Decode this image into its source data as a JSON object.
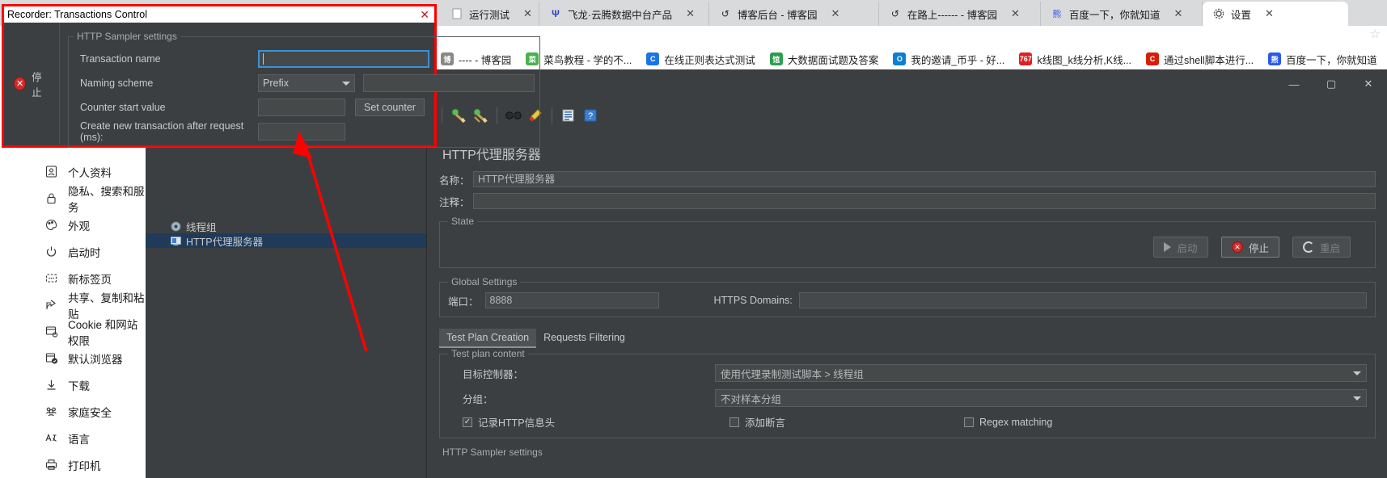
{
  "browser": {
    "tabs": [
      {
        "label": "运行测试",
        "icon": "page-icon",
        "active": false
      },
      {
        "label": "飞龙·云腾数据中台产品",
        "icon": "trident-icon",
        "active": false
      },
      {
        "label": "博客后台 - 博客园",
        "icon": "cnblogs-icon",
        "active": false
      },
      {
        "label": "在路上------ - 博客园",
        "icon": "cnblogs-icon",
        "active": false
      },
      {
        "label": "百度一下，你就知道",
        "icon": "baidu-icon",
        "active": false
      },
      {
        "label": "设置",
        "icon": "gear-icon",
        "active": true
      }
    ],
    "tab_close_label": "✕",
    "bookmarks": [
      {
        "label": "---- - 博客园",
        "icon": "cnblogs-icon",
        "color": "#888888",
        "glyph": "博"
      },
      {
        "label": "菜鸟教程 - 学的不...",
        "icon": "runoob-icon",
        "color": "#4caf50",
        "glyph": "菜"
      },
      {
        "label": "在线正则表达式测试",
        "icon": "regex-icon",
        "color": "#1a73e8",
        "glyph": "C"
      },
      {
        "label": "大数据面试题及答案",
        "icon": "interview-icon",
        "color": "#2e9e4f",
        "glyph": "馆"
      },
      {
        "label": "我的邀请_币乎 - 好...",
        "icon": "bihu-icon",
        "color": "#0b7ed6",
        "glyph": "O"
      },
      {
        "label": "k线图_k线分析,K线...",
        "icon": "kline-icon",
        "color": "#e02020",
        "glyph": "767"
      },
      {
        "label": "通过shell脚本进行...",
        "icon": "csdn-icon",
        "color": "#d81e06",
        "glyph": "C"
      },
      {
        "label": "百度一下，你就知道",
        "icon": "baidu-icon",
        "color": "#2b5ae8",
        "glyph": "熊"
      }
    ],
    "collections_icon": "collections-star-icon"
  },
  "settings_sidebar": {
    "items": [
      {
        "label": "个人资料",
        "icon": "profile-icon"
      },
      {
        "label": "隐私、搜索和服务",
        "icon": "lock-icon"
      },
      {
        "label": "外观",
        "icon": "palette-icon"
      },
      {
        "label": "启动时",
        "icon": "power-icon"
      },
      {
        "label": "新标签页",
        "icon": "newtab-icon"
      },
      {
        "label": "共享、复制和粘贴",
        "icon": "share-icon"
      },
      {
        "label": "Cookie 和网站权限",
        "icon": "cookie-icon"
      },
      {
        "label": "默认浏览器",
        "icon": "default-browser-icon"
      },
      {
        "label": "下载",
        "icon": "download-icon"
      },
      {
        "label": "家庭安全",
        "icon": "family-icon"
      },
      {
        "label": "语言",
        "icon": "language-icon"
      },
      {
        "label": "打印机",
        "icon": "printer-icon"
      }
    ]
  },
  "jmeter": {
    "window_buttons": {
      "minimize": "—",
      "maximize": "▢",
      "close": "✕"
    },
    "toolbar_icons": [
      "stop-grey-icon",
      "clear-icon",
      "clear-all-icon",
      "search-icon",
      "search-reset-icon",
      "function-helper-icon",
      "help-icon"
    ],
    "tree": [
      {
        "label": "线程组",
        "icon": "thread-group-icon",
        "selected": false
      },
      {
        "label": "HTTP代理服务器",
        "icon": "http-proxy-icon",
        "selected": true
      }
    ],
    "panel_title": "HTTP代理服务器",
    "name_label": "名称：",
    "name_value": "HTTP代理服务器",
    "comment_label": "注释：",
    "comment_value": "",
    "state_legend": "State",
    "buttons": {
      "start": "启动",
      "stop": "停止",
      "restart": "重启"
    },
    "global_settings_legend": "Global Settings",
    "port_label": "端口：",
    "port_value": "8888",
    "https_domains_label": "HTTPS Domains:",
    "https_domains_value": "",
    "tabs": [
      {
        "label": "Test Plan Creation",
        "active": true
      },
      {
        "label": "Requests Filtering",
        "active": false
      }
    ],
    "test_plan_legend": "Test plan content",
    "target_controller_label": "目标控制器：",
    "target_controller_value": "使用代理录制测试脚本 > 线程组",
    "grouping_label": "分组：",
    "grouping_value": "不对样本分组",
    "checkboxes": [
      {
        "label": "记录HTTP信息头",
        "checked": true
      },
      {
        "label": "添加断言",
        "checked": false
      },
      {
        "label": "Regex matching",
        "checked": false
      }
    ],
    "bottom_legend": "HTTP Sampler settings"
  },
  "recorder_dialog": {
    "title": "Recorder: Transactions Control",
    "close_label": "✕",
    "stop_button": "停止",
    "fieldset_legend": "HTTP Sampler settings",
    "fields": {
      "transaction_name_label": "Transaction name",
      "transaction_name_value": "",
      "naming_scheme_label": "Naming scheme",
      "naming_scheme_value": "Prefix",
      "naming_scheme_extra_value": "",
      "counter_start_label": "Counter start value",
      "counter_start_value": "",
      "set_counter_button": "Set counter",
      "new_transaction_label": "Create new transaction after request (ms):",
      "new_transaction_value": ""
    }
  },
  "annotation": {
    "arrow_color": "#ff0000",
    "highlight_color": "#ff0000"
  }
}
